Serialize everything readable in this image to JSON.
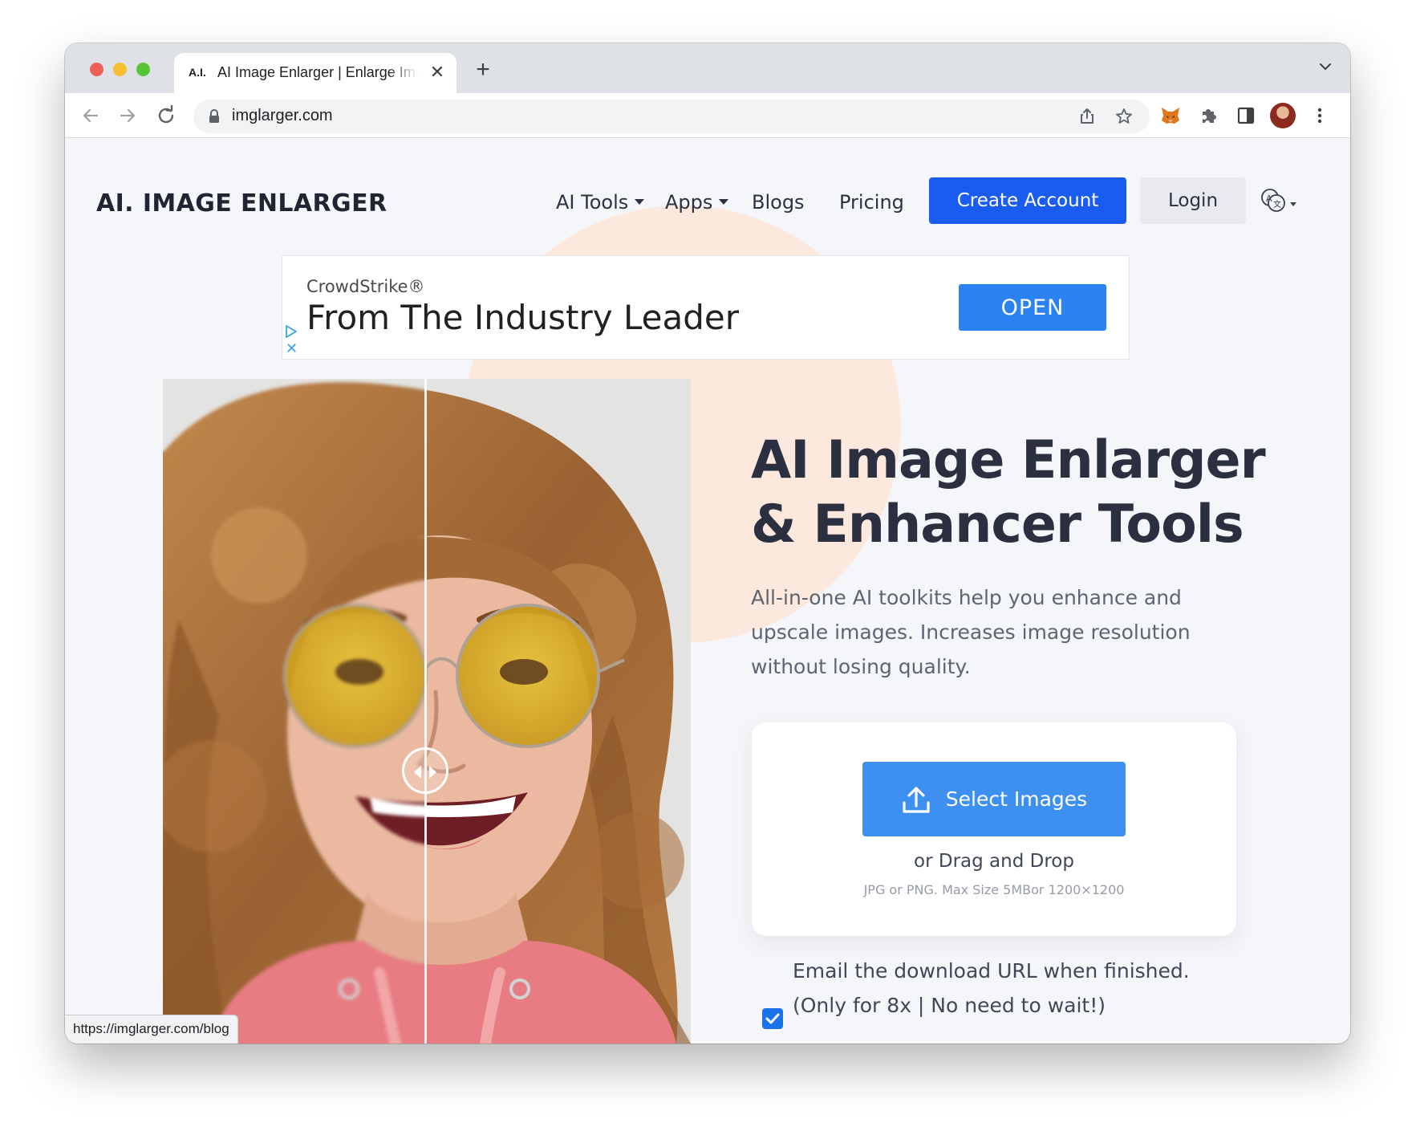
{
  "browser": {
    "tab": {
      "favicon_text": "A.I.",
      "title": "AI Image Enlarger | Enlarge Image",
      "close_glyph": "✕"
    },
    "new_tab_glyph": "+",
    "address": {
      "url": "imglarger.com"
    },
    "status_url": "https://imglarger.com/blog"
  },
  "site": {
    "logo": "AI. IMAGE ENLARGER",
    "nav": {
      "ai_tools": "AI Tools",
      "apps": "Apps",
      "blogs": "Blogs",
      "pricing": "Pricing"
    },
    "create_account": "Create Account",
    "login": "Login"
  },
  "ad": {
    "brand": "CrowdStrike®",
    "headline": "From The Industry Leader",
    "cta": "OPEN",
    "close_glyph": "✕"
  },
  "hero": {
    "title_line1": "AI Image Enlarger",
    "title_line2": "& Enhancer Tools",
    "subtitle": "All-in-one AI toolkits help you enhance and upscale images. Increases image resolution without losing quality."
  },
  "upload": {
    "button": "Select Images",
    "drag_text": "or Drag and Drop",
    "limits": "JPG or PNG. Max Size 5MBor 1200×1200"
  },
  "email_option": {
    "line1": "Email the download URL when finished.",
    "checkbox_label": "(Only for 8x | No need to wait!)",
    "checked": true
  },
  "colors": {
    "primary_blue": "#1a5cf0",
    "select_blue": "#3d8ff0",
    "ad_blue": "#2a83f0",
    "peach": "#fce8dc",
    "page_bg": "#f5f6f9"
  },
  "icons": {
    "tab_menu": "chevron-down-icon",
    "back": "arrow-left-icon",
    "forward": "arrow-right-icon",
    "reload": "reload-icon",
    "lock": "lock-icon",
    "share": "share-icon",
    "bookmark": "star-icon",
    "metamask": "fox-icon",
    "extensions": "puzzle-icon",
    "side_panel": "side-panel-icon",
    "menu": "kebab-menu-icon",
    "language": "language-icon",
    "upload": "upload-icon",
    "ad_choices": "ad-choices-icon"
  }
}
